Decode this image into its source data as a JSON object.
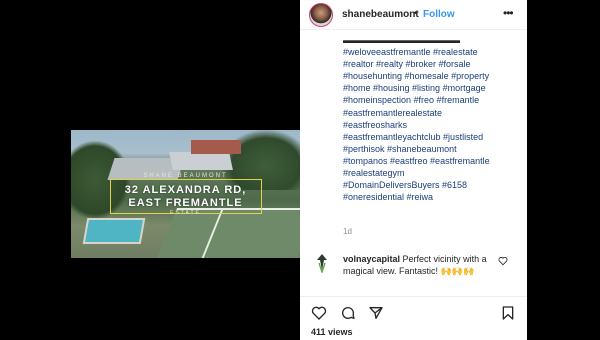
{
  "post": {
    "username": "shanebeaumont",
    "separator": "•",
    "follow_label": "Follow",
    "more_label": "•••"
  },
  "video_overlay": {
    "top_text": "SHANE BEAUMONT",
    "line1": "32 ALEXANDRA RD,",
    "line2": "EAST FREMANTLE",
    "bottom_text": "ESTATE"
  },
  "caption": {
    "censored_line": "▬▬▬▬▬▬▬▬▬▬▬▬▬",
    "lines": [
      "#weloveeastfremantle #realestate",
      "#realtor #realty #broker #forsale",
      "#househunting #homesale #property",
      "#home #housing #listing #mortgage",
      "#homeinspection #freo #fremantle",
      "#eastfremantlerealestate",
      "#eastfreosharks",
      "#eastfremantleyachtclub #justlisted",
      "#perthisok #shanebeaumont",
      "#tompanos #eastfreo #eastfremantle",
      "#realestategym",
      "#DomainDeliversBuyers #6158",
      "#oneresidential #reiwa"
    ]
  },
  "timestamp": "1d",
  "comment": {
    "username": "volnaycapital",
    "text": "Perfect vicinity with a magical view. Fantastic!",
    "emoji": "🙌🙌🙌"
  },
  "stats": {
    "views": "411 views"
  },
  "colors": {
    "hashtag": "#1b3f7a",
    "follow": "#3897f0",
    "overlay_border": "#e0d34a"
  }
}
